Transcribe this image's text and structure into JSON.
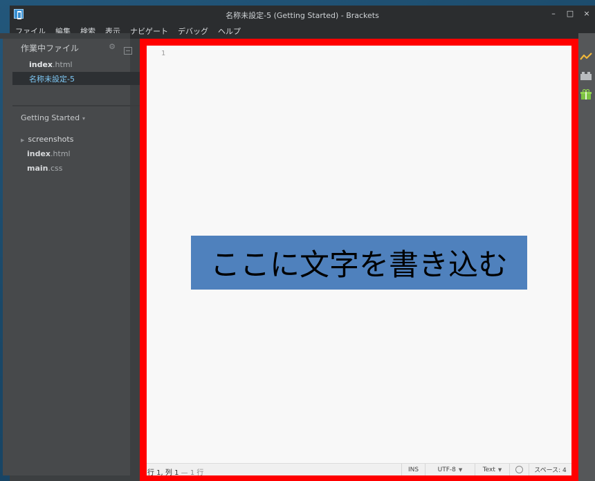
{
  "window": {
    "title": "名称未設定-5 (Getting Started) - Brackets",
    "controls": {
      "minimize": "–",
      "maximize": "□",
      "close": "×"
    }
  },
  "menubar": [
    "ファイル",
    "編集",
    "検索",
    "表示",
    "ナビゲート",
    "デバッグ",
    "ヘルプ"
  ],
  "sidebar": {
    "working_files_title": "作業中ファイル",
    "working_files": [
      {
        "name": "index",
        "ext": ".html",
        "selected": false
      },
      {
        "name": "名称未設定-5",
        "ext": "",
        "selected": true
      }
    ],
    "project_name": "Getting Started",
    "project_caret": "▾",
    "tree": [
      {
        "type": "folder",
        "name": "screenshots"
      },
      {
        "type": "file",
        "name": "index",
        "ext": ".html"
      },
      {
        "type": "file",
        "name": "main",
        "ext": ".css"
      }
    ]
  },
  "editor": {
    "line_numbers": [
      "1"
    ],
    "overlay_text": "ここに文字を書き込む",
    "colors": {
      "frame": "#ff0000",
      "overlay": "#4f81bd"
    }
  },
  "statusbar": {
    "cursor": "行 1, 列 1",
    "line_count": "— 1 行",
    "insert_mode": "INS",
    "encoding": "UTF-8",
    "language": "Text",
    "indent": "スペース: 4"
  },
  "toolbar_icons": [
    "live-preview-icon",
    "extension-manager-icon",
    "gift-icon"
  ]
}
